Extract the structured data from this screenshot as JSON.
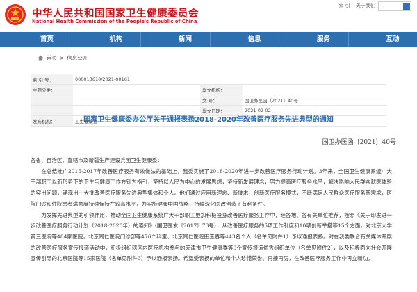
{
  "header": {
    "title": "中华人民共和国国家卫生健康委员会",
    "subtitle": "National Health Commission of the People's Republic of China",
    "links": [
      "索 引",
      "关于我们"
    ]
  },
  "nav": {
    "items": [
      "首页",
      "机构",
      "新闻",
      "信息",
      "服务",
      "互动"
    ]
  },
  "breadcrumb": {
    "home": "首页",
    "separator": ">",
    "current": "信息公开"
  },
  "info": {
    "index_label": "索 引 号：",
    "index_value": "000013610/2021-00161",
    "subject_label": "主题分类：",
    "subject_value": "",
    "issuer_label": "发文机构：",
    "issuer_value": "",
    "docno_label": "文 号：",
    "docno_value": "国卫办医函〔2021〕40号",
    "date_label": "发文日期：",
    "date_value": "2021-02-02",
    "publisher_label": "发布机构：",
    "publisher_value": "卫生健康委"
  },
  "article": {
    "title": "国家卫生健康委办公厅关于通报表扬2018-2020年改善医疗服务先进典型的通知",
    "doc_number": "国卫办医函〔2021〕40号",
    "salutation": "各省、自治区、直辖市及新疆生产建设兵团卫生健康委：",
    "para1": "在总结推广2015-2017年改善医疗服务有效做法的基础上，我委实施了2018-2020年进一步改善医疗服务行动计划。3年来，全国卫生健康系统广大干部职工以新形势下的卫生与健康工作方针为指引，坚持以人民为中心的发展思想，坚持新发展理念，努力提高医疗服务水平，解决影响人民群众就医体验的突出问题，涌现出一大批改善医疗服务先进典型集体和个人。他们通过应用新理念、新技术，创新医疗服务模式，不断满足人民群众医疗服务新需求，医院门诊和住院患者满意度持续保持在较高水平，为实施健康中国战略，持续深化医改创造了有利条件。",
    "para2": "为发挥先进典型的引领作用，推动全国卫生健康系统广大干部职工更加积极投身改善医疗服务工作中，经各地、各有关单位推荐，按照《关于印发进一步改善医疗服务行动计划（2018-2020年）的通知》（国卫医发〔2017〕73号），从改善医疗服务的5项工作制度和10项创新举措等15个方面，对北京大学第三医院等484家医院，北京同仁医院门诊部等476个科室、北京同仁医院田玉春等443名个人（名单见附件1）予以通报表扬。对在我委联合有关媒体开展的改善医疗服务宣传报道活动中，积极组织辖区内医疗机构参与的天津市卫生健康委等9个宣传报道优秀组织单位（名单见附件2），以及积极面向社会开展宣传引导的北京医院等15家医院（名单见附件3）予以通报表扬。希望受表扬的单位和个人珍惜荣誉、再接再厉，在改善医疗服务工作中再立新功。"
  },
  "colors": {
    "brand_red": "#c8161d",
    "nav_blue": "#2e6fb0",
    "title_blue": "#2b6cb0"
  }
}
